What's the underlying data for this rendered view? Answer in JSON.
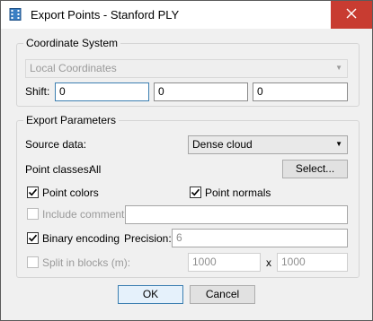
{
  "window": {
    "title": "Export Points - Stanford PLY"
  },
  "coordinate_system": {
    "group_title": "Coordinate System",
    "crs_value": "Local Coordinates",
    "shift_label": "Shift:",
    "shift_x": "0",
    "shift_y": "0",
    "shift_z": "0"
  },
  "export_parameters": {
    "group_title": "Export Parameters",
    "source_label": "Source data:",
    "source_value": "Dense cloud",
    "point_classes_label": "Point classes:",
    "point_classes_value": "All",
    "select_button": "Select...",
    "point_colors": {
      "label": "Point colors",
      "checked": true
    },
    "point_normals": {
      "label": "Point normals",
      "checked": true
    },
    "include_comment": {
      "label": "Include comment",
      "checked": false,
      "value": ""
    },
    "binary_encoding": {
      "label": "Binary encoding",
      "checked": true
    },
    "precision_label": "Precision:",
    "precision_value": "6",
    "split_blocks": {
      "label": "Split in blocks (m):",
      "checked": false
    },
    "block_x": "1000",
    "block_sep": "x",
    "block_y": "1000"
  },
  "buttons": {
    "ok": "OK",
    "cancel": "Cancel"
  }
}
